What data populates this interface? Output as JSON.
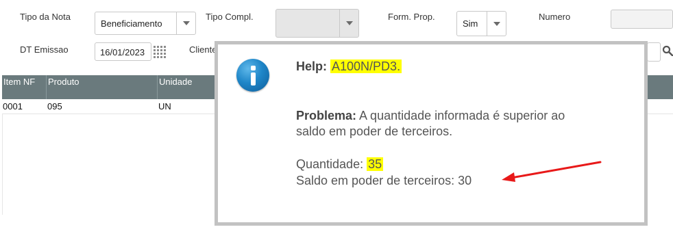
{
  "form": {
    "tipo_nota_label": "Tipo da Nota",
    "tipo_nota_value": "Beneficiamento",
    "tipo_compl_label": "Tipo Compl.",
    "tipo_compl_value": "",
    "form_prop_label": "Form. Prop.",
    "form_prop_value": "Sim",
    "numero_label": "Numero",
    "dt_emissao_label": "DT Emissao",
    "dt_emissao_value": "16/01/2023",
    "cliente_label": "Cliente"
  },
  "grid": {
    "columns": [
      "Item NF",
      "Produto",
      "Unidade"
    ],
    "rows": [
      [
        "0001",
        "095",
        "UN"
      ]
    ]
  },
  "dialog": {
    "help_label": "Help:",
    "help_code": "A100N/PD3.",
    "problema_label": "Problema:",
    "problema_line1": "A quantidade informada é superior ao",
    "problema_line2": "saldo em poder de terceiros.",
    "quantidade_label": "Quantidade:",
    "quantidade_value": "35",
    "saldo_line": "Saldo em poder de terceiros: 30"
  },
  "colors": {
    "grid_header": "#6a7a7d",
    "highlight": "#ffff00",
    "arrow": "#e81919",
    "info_icon": "#1f86c8"
  },
  "icons": [
    "chevron-down-icon",
    "calendar-grid-icon",
    "search-icon",
    "info-icon",
    "red-arrow-annotation"
  ]
}
